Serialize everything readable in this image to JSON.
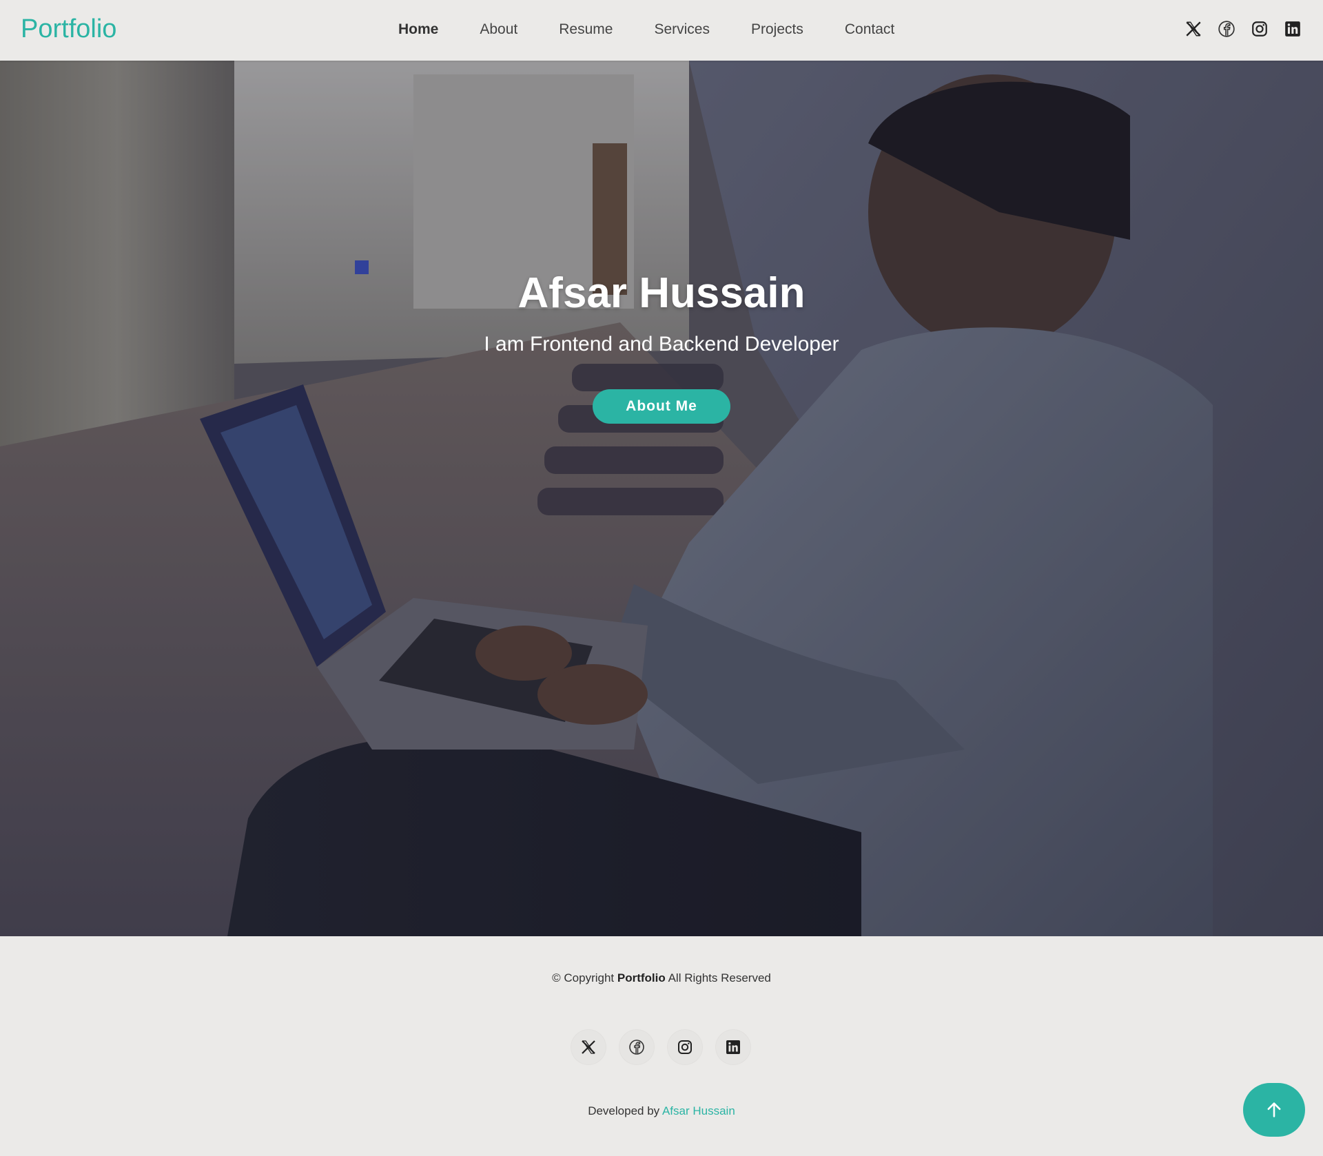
{
  "header": {
    "logo": "Portfolio",
    "nav": [
      {
        "label": "Home",
        "active": true
      },
      {
        "label": "About"
      },
      {
        "label": "Resume"
      },
      {
        "label": "Services"
      },
      {
        "label": "Projects"
      },
      {
        "label": "Contact"
      }
    ],
    "social_icons": [
      "x-icon",
      "facebook-icon",
      "instagram-icon",
      "linkedin-icon"
    ]
  },
  "hero": {
    "title": "Afsar Hussain",
    "subtitle": "I am Frontend and Backend Developer",
    "button_label": "About Me"
  },
  "footer": {
    "copyright_prefix": "© Copyright",
    "copyright_brand": "Portfolio",
    "copyright_suffix": "All Rights Reserved",
    "social_icons": [
      "x-icon",
      "facebook-icon",
      "instagram-icon",
      "linkedin-icon"
    ],
    "developed_by_prefix": "Developed by",
    "developed_by_name": "Afsar Hussain"
  },
  "colors": {
    "accent": "#2bb4a4",
    "background": "#ebeae8",
    "text": "#333333"
  }
}
